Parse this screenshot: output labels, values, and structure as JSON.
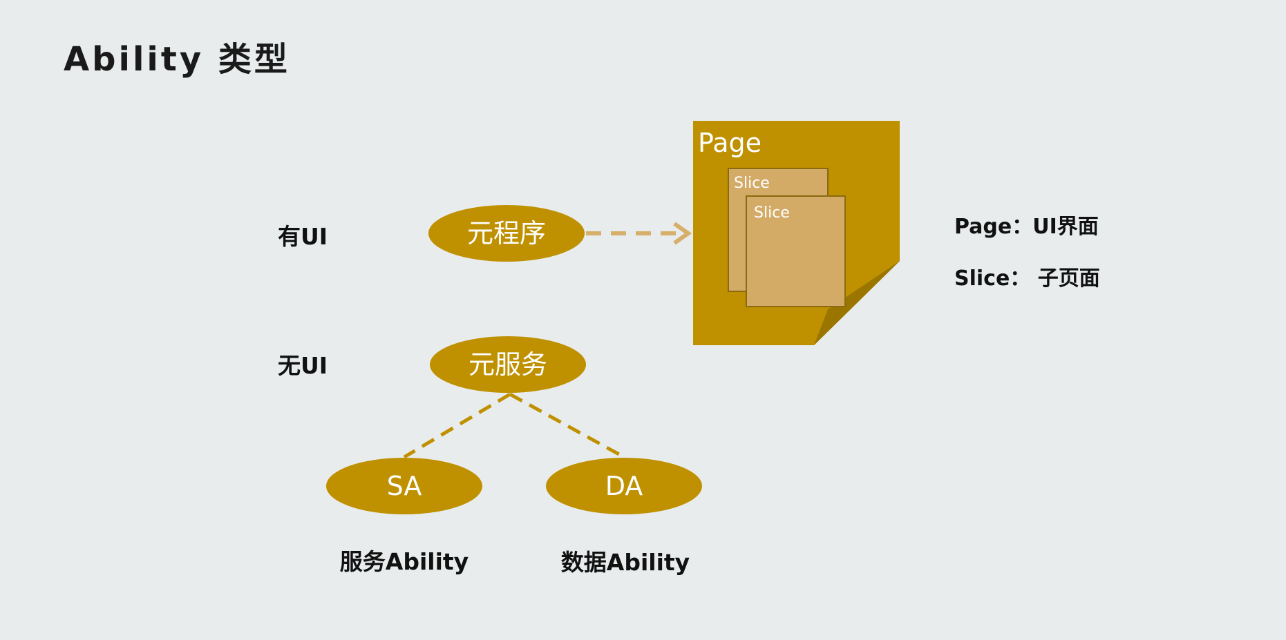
{
  "title": "Ability 类型",
  "rows": {
    "with_ui": "有UI",
    "without_ui": "无UI"
  },
  "nodes": {
    "meta_program": "元程序",
    "meta_service": "元服务",
    "sa": "SA",
    "da": "DA"
  },
  "page_card": {
    "title": "Page",
    "slice_back": "Slice",
    "slice_front": "Slice"
  },
  "captions": {
    "sa": "服务Ability",
    "da": "数据Ability"
  },
  "legend": {
    "page": "Page：UI界面",
    "slice": "Slice： 子页面"
  },
  "colors": {
    "background": "#e8eced",
    "gold": "#bf9000",
    "gold_dark": "#9a7600",
    "slice_fill": "#d3ab67",
    "slice_border": "#8a6a10",
    "arrow": "#d6b06a"
  }
}
